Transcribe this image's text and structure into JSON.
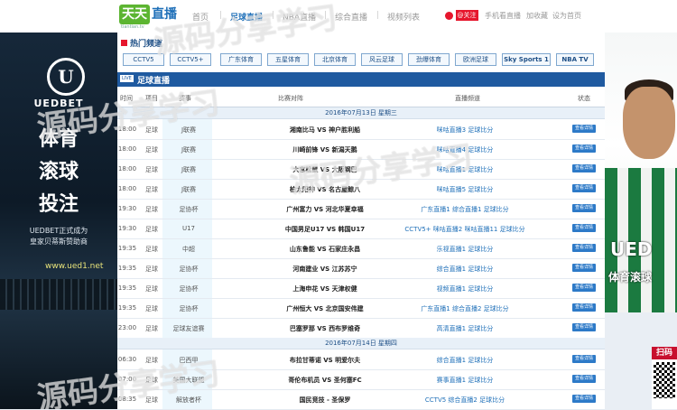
{
  "header": {
    "logo_main": "天天",
    "logo_sub": "直播",
    "logo_domain": "tiantian.tv",
    "nav": [
      "首页",
      "足球直播",
      "NBA直播",
      "综合直播",
      "视频列表"
    ],
    "weibo_label": "@关注",
    "tools": [
      "手机看直播",
      "加收藏",
      "设为首页"
    ]
  },
  "ad_left": {
    "logo_letter": "U",
    "brand": "UEDBET",
    "line1": "体育",
    "line2": "滚球",
    "line3": "投注",
    "desc1": "UEDBET正式成为",
    "desc2": "皇家贝蒂斯赞助商",
    "url": "www.ued1.net"
  },
  "ad_right": {
    "text1": "UED",
    "text2": "体育滚球"
  },
  "qr": {
    "label": "扫码"
  },
  "hot": {
    "title": "热门频道",
    "channels": [
      "CCTV5",
      "CCTV5+",
      "广东体育",
      "五星体育",
      "北京体育",
      "风云足球",
      "劲爆体育",
      "欧洲足球",
      "Sky Sports 1",
      "NBA TV"
    ]
  },
  "section": {
    "badge": "LIVE",
    "title": "足球直播"
  },
  "table_header": [
    "时间",
    "项目",
    "赛事",
    "比赛对阵",
    "直播频道",
    "状态"
  ],
  "rows": [
    {
      "type": "date",
      "text": "2016年07月13日 星期三"
    },
    {
      "time": "18:00",
      "sport": "足球",
      "league": "J联赛",
      "match": "湘南比马 VS 神户胜利船",
      "channels": "咪咕直播3  足球比分",
      "status": "查看详情"
    },
    {
      "time": "18:00",
      "sport": "足球",
      "league": "J联赛",
      "match": "川崎前锋 VS 新潟天鹅",
      "channels": "咪咕直播4  足球比分",
      "status": "查看详情"
    },
    {
      "time": "18:00",
      "sport": "足球",
      "league": "J联赛",
      "match": "大宫松鼠 VS 大阪钢巴",
      "channels": "咪咕直播1  足球比分",
      "status": "查看详情"
    },
    {
      "time": "18:00",
      "sport": "足球",
      "league": "J联赛",
      "match": "柏太阳神 VS 名古屋鲸八",
      "channels": "咪咕直播5  足球比分",
      "status": "查看详情"
    },
    {
      "time": "19:30",
      "sport": "足球",
      "league": "足协杯",
      "match": "广州富力 VS 河北华夏幸福",
      "channels": "广东直播1  综合直播1  足球比分",
      "status": "查看详情"
    },
    {
      "time": "19:30",
      "sport": "足球",
      "league": "U17",
      "match": "中国男足U17 VS 韩国U17",
      "channels": "CCTV5+  咪咕直播2  咪咕直播11  足球比分",
      "status": "查看详情"
    },
    {
      "time": "19:35",
      "sport": "足球",
      "league": "中超",
      "match": "山东鲁能 VS 石家庄永昌",
      "channels": "乐视直播1  足球比分",
      "status": "查看详情"
    },
    {
      "time": "19:35",
      "sport": "足球",
      "league": "足协杯",
      "match": "河南建业 VS 江苏苏宁",
      "channels": "综合直播1  足球比分",
      "status": "查看详情"
    },
    {
      "time": "19:35",
      "sport": "足球",
      "league": "足协杯",
      "match": "上海申花 VS 天津权健",
      "channels": "视频直播1  足球比分",
      "status": "查看详情"
    },
    {
      "time": "19:35",
      "sport": "足球",
      "league": "足协杯",
      "match": "广州恒大 VS 北京国安伟建",
      "channels": "广东直播1  综合直播2  足球比分",
      "status": "查看详情"
    },
    {
      "time": "23:00",
      "sport": "足球",
      "league": "足球友谊赛",
      "match": "巴塞罗那 VS 西布罗维奇",
      "channels": "高清直播1  足球比分",
      "status": "查看详情"
    },
    {
      "type": "date",
      "text": "2016年07月14日 星期四"
    },
    {
      "time": "06:30",
      "sport": "足球",
      "league": "巴西甲",
      "match": "布拉甘蒂诺 VS 明爱尔夫",
      "channels": "综合直播1  足球比分",
      "status": "查看详情"
    },
    {
      "time": "07:00",
      "sport": "足球",
      "league": "美国大联盟",
      "match": "哥伦布机员 VS 圣何塞FC",
      "channels": "赛事直播1  足球比分",
      "status": "查看详情"
    },
    {
      "time": "08:35",
      "sport": "足球",
      "league": "解放者杯",
      "match": "国民竞技 - 圣保罗",
      "channels": "CCTV5  综合直播2  足球比分",
      "status": "查看详情"
    }
  ],
  "watermark": [
    "源码分享学习",
    "源码分享学习",
    "源码分享学习",
    "源码分享学习"
  ]
}
